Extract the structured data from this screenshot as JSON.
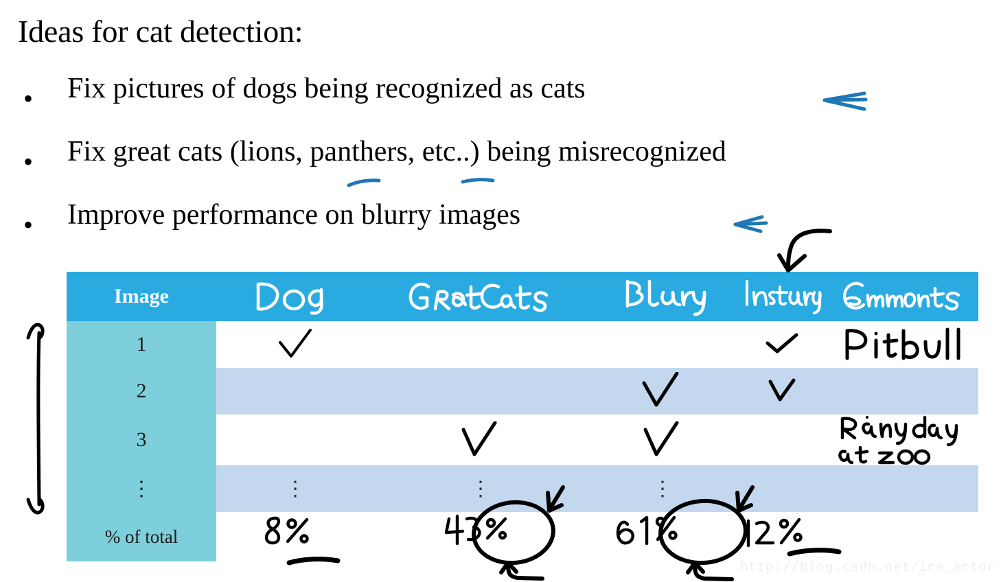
{
  "slide": {
    "heading": "Ideas for cat detection:",
    "bullets": [
      {
        "marker": "•",
        "text": "Fix pictures of dogs being recognized as cats"
      },
      {
        "marker": "•",
        "text": "Fix great cats (lions, panthers, etc..) being misrecognized"
      },
      {
        "marker": "•",
        "text": "Improve performance on blurry images"
      }
    ],
    "watermark": "http://blog.csdn.net/ice_actor"
  },
  "colors": {
    "header_blue": "#29ABE2",
    "index_teal": "#7ECFDC",
    "row_alt_blue": "#C3D8EE",
    "row_white": "#FFFFFF",
    "annotation_blue": "#1F77B4",
    "ink_black": "#000000",
    "watermark_grey": "#EFEFEF"
  },
  "table": {
    "columns": [
      {
        "key": "image",
        "label": "Image",
        "style": "typed"
      },
      {
        "key": "dog",
        "label": "Dog",
        "style": "handwritten"
      },
      {
        "key": "great",
        "label": "Great Cats",
        "style": "handwritten"
      },
      {
        "key": "blurry",
        "label": "Blurry",
        "style": "handwritten"
      },
      {
        "key": "insta",
        "label": "Instagram",
        "style": "handwritten"
      },
      {
        "key": "comments",
        "label": "Comments",
        "style": "handwritten"
      }
    ],
    "rows": [
      {
        "image": "1",
        "shade": "white",
        "dog": "check",
        "great": "",
        "blurry": "",
        "insta": "check",
        "comments": "Pitbull"
      },
      {
        "image": "2",
        "shade": "blue",
        "dog": "",
        "great": "",
        "blurry": "check",
        "insta": "check",
        "comments": ""
      },
      {
        "image": "3",
        "shade": "white",
        "dog": "",
        "great": "check",
        "blurry": "check",
        "insta": "",
        "comments": "Rainy day at zoo"
      },
      {
        "image": "⋮",
        "shade": "blue",
        "dog": "⋮",
        "great": "⋮",
        "blurry": "⋮",
        "insta": "",
        "comments": ""
      }
    ],
    "total_row": {
      "label": "% of total",
      "shade": "none",
      "dog": "8%",
      "great": "43%",
      "blurry": "61%",
      "insta": "12%",
      "comments": ""
    }
  },
  "annotations": [
    {
      "name": "blue-arrow-bullet-1",
      "type": "arrow-left",
      "color": "#1F77B4"
    },
    {
      "name": "blue-underline-lions",
      "type": "underline",
      "color": "#1F77B4"
    },
    {
      "name": "blue-underline-panthers",
      "type": "underline",
      "color": "#1F77B4"
    },
    {
      "name": "blue-arrow-bullet-3",
      "type": "arrow-left",
      "color": "#1F77B4"
    },
    {
      "name": "black-curved-arrow-to-instagram",
      "type": "curved-arrow-down",
      "color": "#000000"
    },
    {
      "name": "black-double-arrow-rows",
      "type": "double-arrow-vertical",
      "color": "#000000"
    },
    {
      "name": "circle-great-cats-total",
      "type": "ellipse",
      "color": "#000000"
    },
    {
      "name": "circle-blurry-total",
      "type": "ellipse",
      "color": "#000000"
    },
    {
      "name": "underline-dog-total",
      "type": "underline",
      "color": "#000000"
    },
    {
      "name": "underline-instagram-total",
      "type": "underline",
      "color": "#000000"
    },
    {
      "name": "up-arrow-great-cats",
      "type": "arrow-up",
      "color": "#000000"
    },
    {
      "name": "up-arrow-blurry",
      "type": "arrow-up",
      "color": "#000000"
    },
    {
      "name": "down-arrow-great-cats-dots",
      "type": "arrow-down-small",
      "color": "#000000"
    },
    {
      "name": "down-arrow-blurry-dots",
      "type": "arrow-down-small",
      "color": "#000000"
    }
  ]
}
